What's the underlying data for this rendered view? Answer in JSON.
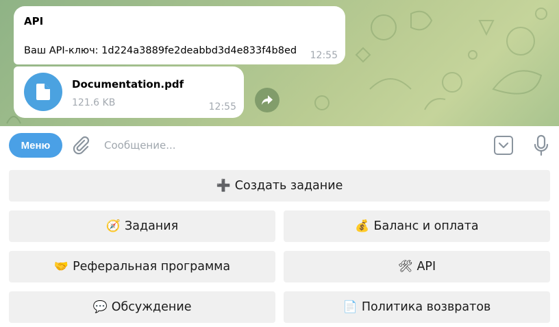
{
  "messages": [
    {
      "title": "API",
      "text": "Ваш API-ключ: 1d224a3889fe2deabbd3d4e833f4b8ed",
      "time": "12:55"
    },
    {
      "file_name": "Documentation.pdf",
      "file_size": "121.6 KB",
      "time": "12:55",
      "icon": "file-icon"
    }
  ],
  "input": {
    "menu_label": "Меню",
    "placeholder": "Сообщение...",
    "value": ""
  },
  "keyboard": {
    "create": {
      "emoji": "➕",
      "label": "Создать задание"
    },
    "tasks": {
      "emoji": "🧭",
      "label": "Задания"
    },
    "balance": {
      "emoji": "💰",
      "label": "Баланс и оплата"
    },
    "referral": {
      "emoji": "🤝",
      "label": "Реферальная программа"
    },
    "api": {
      "emoji": "🛠",
      "label": "API"
    },
    "discussion": {
      "emoji": "💬",
      "label": "Обсуждение"
    },
    "refund": {
      "emoji": "📄",
      "label": "Политика возвратов"
    }
  },
  "colors": {
    "accent": "#4aa0e6",
    "bubble": "#ffffff",
    "time": "#a3a9b0",
    "keyboard_button": "#f0f0f0"
  }
}
